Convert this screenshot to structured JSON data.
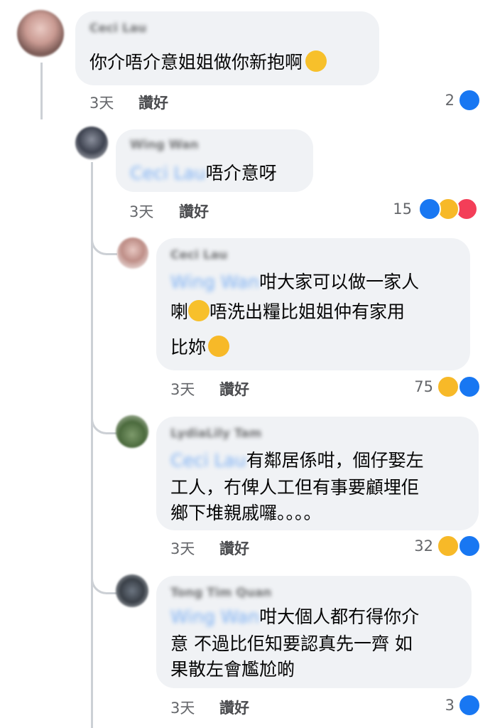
{
  "comments": [
    {
      "author": "Ceci Lau",
      "mention": "",
      "text_lines": [
        "你介唔介意姐姐做你新抱啊"
      ],
      "time": "3天",
      "like_label": "讚好",
      "reaction_count": "2",
      "reactions": [
        "like-icon"
      ]
    },
    {
      "author": "Wing Wan",
      "mention": "Ceci Lau",
      "text_lines": [
        "唔介意呀"
      ],
      "time": "3天",
      "like_label": "讚好",
      "reaction_count": "15",
      "reactions": [
        "like-icon",
        "care-icon",
        "love-icon"
      ]
    },
    {
      "author": "Ceci Lau",
      "mention": "Wing Wan",
      "text_lines": [
        "咁大家可以做一家人",
        "喇",
        "唔洗出糧比姐姐仲有家用",
        "比妳"
      ],
      "time": "3天",
      "like_label": "讚好",
      "reaction_count": "75",
      "reactions": [
        "haha-icon",
        "like-icon"
      ]
    },
    {
      "author": "LydiaLily Tam",
      "mention": "Ceci Lau",
      "text_lines": [
        "有鄰居係咁，個仔娶左",
        "工人，冇俾人工但有事要顧埋佢",
        "鄉下堆親戚囉。。。。"
      ],
      "time": "3天",
      "like_label": "讚好",
      "reaction_count": "32",
      "reactions": [
        "haha-icon",
        "like-icon"
      ]
    },
    {
      "author": "Tong Tim Quan",
      "mention": "Wing Wan",
      "text_lines": [
        "咁大個人都冇得你介",
        "意 不過比佢知要認真先一齊 如",
        "果散左會尷尬啲"
      ],
      "time": "3天",
      "like_label": "讚好",
      "reaction_count": "3",
      "reactions": [
        "like-icon"
      ]
    }
  ],
  "colors": {
    "bubble": "#f0f2f5",
    "like_blue": "#1877f2",
    "mention_blue": "#1877f2",
    "meta_gray": "#65676b",
    "thread_line": "#ccd0d5"
  }
}
